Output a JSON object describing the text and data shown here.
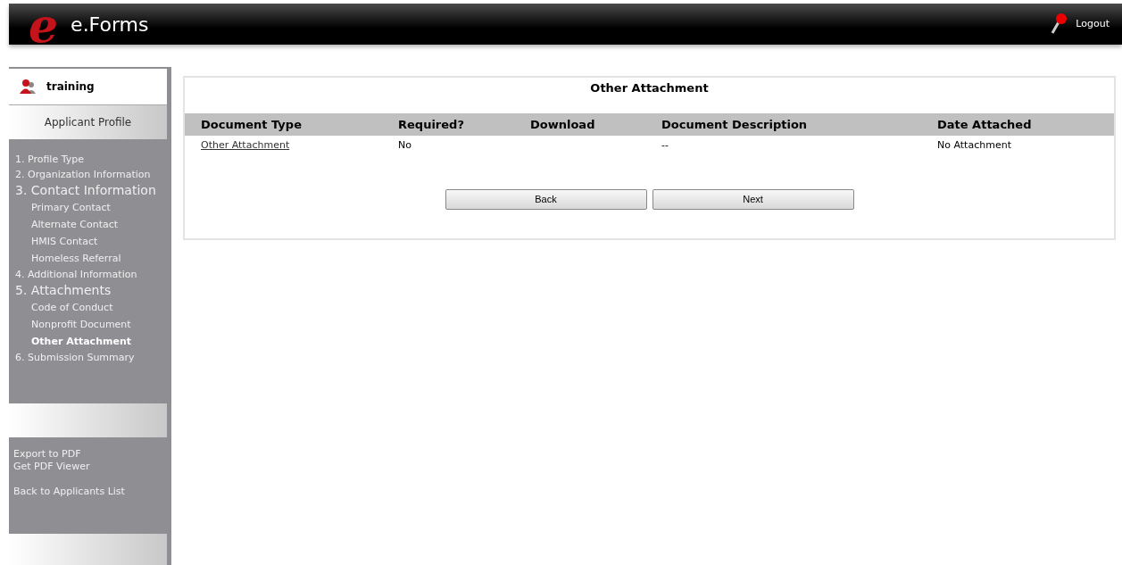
{
  "header": {
    "logo_letter": "e",
    "title": "e.Forms",
    "logout": "Logout"
  },
  "sidebar": {
    "user": "training",
    "profile_button": "Applicant Profile",
    "items": [
      {
        "label": "1. Profile Type",
        "kind": "step",
        "selected": false
      },
      {
        "label": "2. Organization Information",
        "kind": "step",
        "selected": false
      },
      {
        "label": "3. Contact Information",
        "kind": "section",
        "selected": false
      },
      {
        "label": "Primary Contact",
        "kind": "sub",
        "selected": false
      },
      {
        "label": "Alternate Contact",
        "kind": "sub",
        "selected": false
      },
      {
        "label": "HMIS Contact",
        "kind": "sub",
        "selected": false
      },
      {
        "label": "Homeless Referral",
        "kind": "sub",
        "selected": false
      },
      {
        "label": "4. Additional Information",
        "kind": "step",
        "selected": false
      },
      {
        "label": "5. Attachments",
        "kind": "section",
        "selected": false
      },
      {
        "label": "Code of Conduct",
        "kind": "sub",
        "selected": false
      },
      {
        "label": "Nonprofit Document",
        "kind": "sub",
        "selected": false
      },
      {
        "label": "Other Attachment",
        "kind": "sub",
        "selected": true
      },
      {
        "label": "6. Submission Summary",
        "kind": "step",
        "selected": false
      }
    ],
    "links": [
      [
        "Export to PDF",
        "Get PDF Viewer"
      ],
      [
        "Back to Applicants List"
      ]
    ]
  },
  "panel": {
    "title": "Other Attachment",
    "table": {
      "columns": [
        "Document Type",
        "Required?",
        "Download",
        "Document Description",
        "Date Attached"
      ],
      "rows": [
        [
          "Other Attachment",
          "No",
          "",
          "--",
          "No Attachment"
        ]
      ]
    },
    "buttons": [
      "Back",
      "Next"
    ]
  }
}
